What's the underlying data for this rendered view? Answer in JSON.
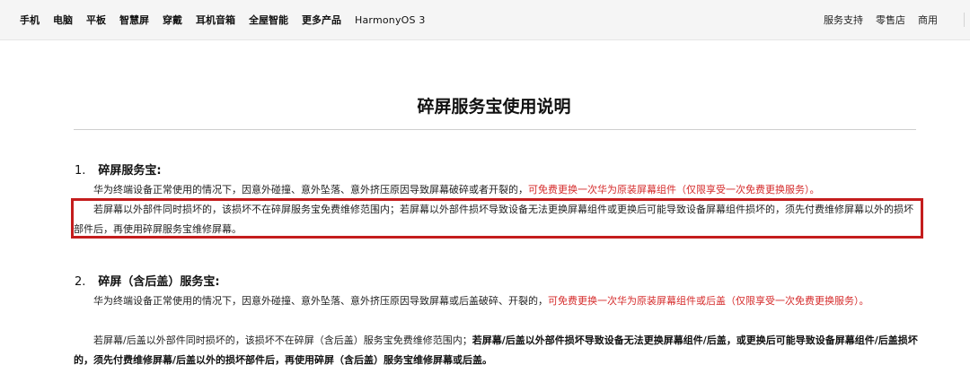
{
  "nav": {
    "left": [
      "手机",
      "电脑",
      "平板",
      "智慧屏",
      "穿戴",
      "耳机音箱",
      "全屋智能",
      "更多产品",
      "HarmonyOS 3"
    ],
    "right": [
      "服务支持",
      "零售店",
      "商用"
    ]
  },
  "title": "碎屏服务宝使用说明",
  "section1": {
    "number": "1.",
    "heading": "碎屏服务宝:",
    "p1_plain": "华为终端设备正常使用的情况下，因意外碰撞、意外坠落、意外挤压原因导致屏幕破碎或者开裂的，",
    "p1_red": "可免费更换一次华为原装屏幕组件（仅限享受一次免费更换服务）。",
    "p2": "若屏幕以外部件同时损坏的，该损坏不在碎屏服务宝免费维修范围内；若屏幕以外部件损坏导致设备无法更换屏幕组件或更换后可能导致设备屏幕组件损坏的，须先付费维修屏幕以外的损坏部件后，再使用碎屏服务宝维修屏幕。"
  },
  "section2": {
    "number": "2.",
    "heading": "碎屏（含后盖）服务宝:",
    "p1_plain": "华为终端设备正常使用的情况下，因意外碰撞、意外坠落、意外挤压原因导致屏幕或后盖破碎、开裂的，",
    "p1_red": "可免费更换一次华为原装屏幕组件或后盖（仅限享受一次免费更换服务）。",
    "p2_plain": "若屏幕/后盖以外部件同时损坏的，该损坏不在碎屏（含后盖）服务宝免费维修范围内；",
    "p2_bold": "若屏幕/后盖以外部件损坏导致设备无法更换屏幕组件/后盖，或更换后可能导致设备屏幕组件/后盖损坏的，须先付费维修屏幕/后盖以外的损坏部件后，再使用碎屏（含后盖）服务宝维修屏幕或后盖。"
  },
  "colors": {
    "accent_red": "#d52b2b",
    "box_red": "#c41d1d",
    "nav_bg": "#f5f5f5"
  }
}
